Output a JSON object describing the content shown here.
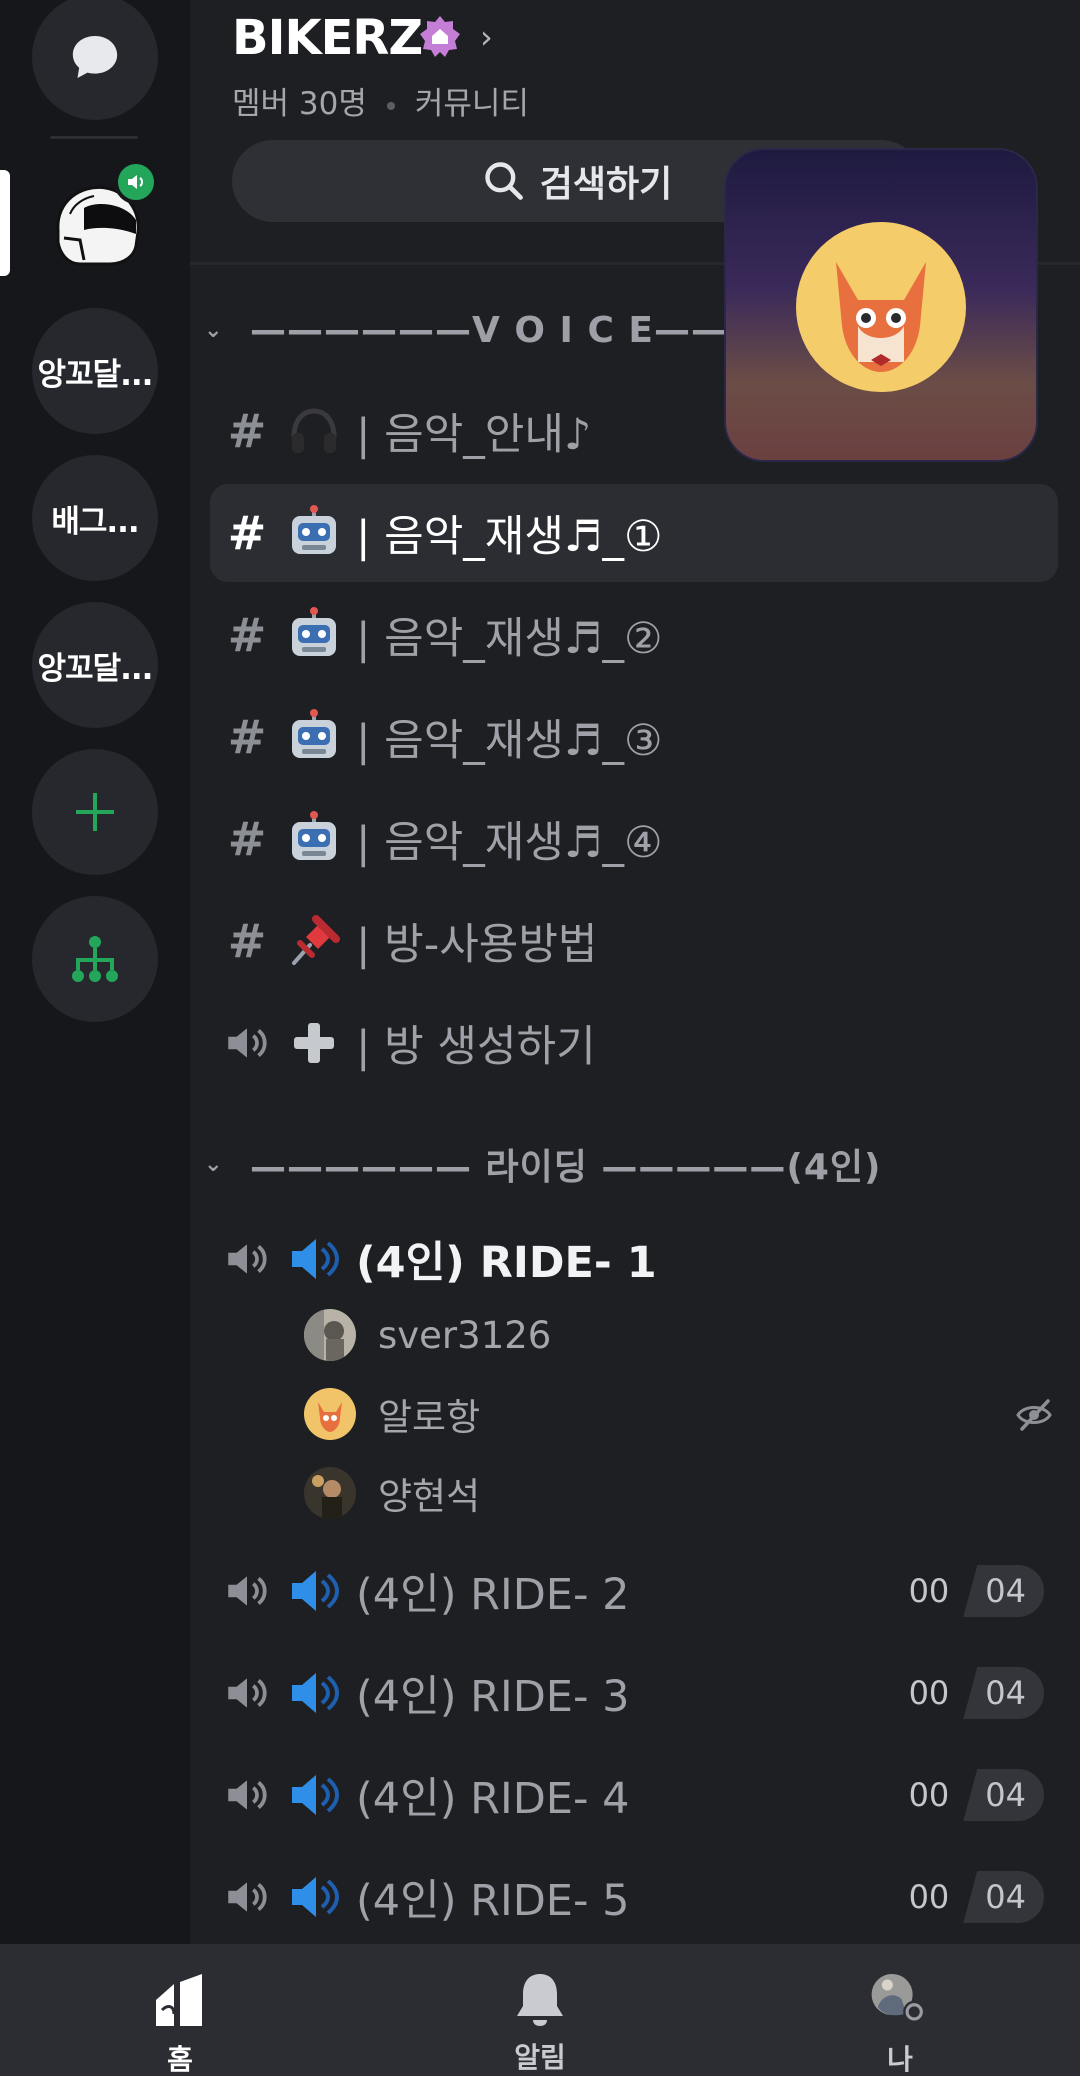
{
  "server": {
    "name": "BIKERZ",
    "member_count": "멤버 30명",
    "type": "커뮤니티"
  },
  "search": {
    "label": "검색하기"
  },
  "rail": {
    "servers": [
      {
        "kind": "dm",
        "icon": "chat-bubble-icon"
      },
      {
        "kind": "image",
        "icon": "helmet-icon",
        "selected": true,
        "voice_active": true
      },
      {
        "kind": "text",
        "label": "앙꼬달..."
      },
      {
        "kind": "text",
        "label": "배그..."
      },
      {
        "kind": "text",
        "label": "앙꼬달..."
      },
      {
        "kind": "action",
        "icon": "plus-icon"
      },
      {
        "kind": "action",
        "icon": "server-directory-icon"
      }
    ]
  },
  "categories": [
    {
      "label": "——————V O I C E————"
    },
    {
      "label": "—————— 라이딩 —————(4인)"
    }
  ],
  "channels": [
    {
      "type": "text",
      "emoji": "headphone-emoji",
      "name": "| 음악_안내♪",
      "active": false
    },
    {
      "type": "text",
      "emoji": "robot-emoji",
      "name": "| 음악_재생♬_①",
      "active": true
    },
    {
      "type": "text",
      "emoji": "robot-emoji",
      "name": "| 음악_재생♬_②",
      "active": false
    },
    {
      "type": "text",
      "emoji": "robot-emoji",
      "name": "| 음악_재생♬_③",
      "active": false
    },
    {
      "type": "text",
      "emoji": "robot-emoji",
      "name": "| 음악_재생♬_④",
      "active": false
    },
    {
      "type": "text",
      "emoji": "pushpin-emoji",
      "name": "| 방-사용방법",
      "active": false
    },
    {
      "type": "voice",
      "emoji": "heavy-plus-emoji",
      "name": "| 방 생성하기",
      "active": false
    }
  ],
  "ride_channels": [
    {
      "emoji": "speaker-emoji",
      "name": "(4인) RIDE- 1",
      "connected": true,
      "users": [
        {
          "name": "sver3126",
          "muted_icon": false
        },
        {
          "name": "알로항",
          "muted_icon": true
        },
        {
          "name": "양현석",
          "muted_icon": false
        }
      ]
    },
    {
      "emoji": "speaker-emoji",
      "name": "(4인) RIDE- 2",
      "count_current": "00",
      "count_limit": "04"
    },
    {
      "emoji": "speaker-emoji",
      "name": "(4인) RIDE- 3",
      "count_current": "00",
      "count_limit": "04"
    },
    {
      "emoji": "speaker-emoji",
      "name": "(4인) RIDE- 4",
      "count_current": "00",
      "count_limit": "04"
    },
    {
      "emoji": "speaker-emoji",
      "name": "(4인) RIDE- 5",
      "count_current": "00",
      "count_limit": "04"
    }
  ],
  "nav": {
    "home": "홈",
    "alerts": "알림",
    "me": "나"
  },
  "colors": {
    "background": "#1e1f23",
    "rail": "#16171b",
    "accent_green": "#23a55a",
    "boost_purple": "#c47ed6"
  }
}
